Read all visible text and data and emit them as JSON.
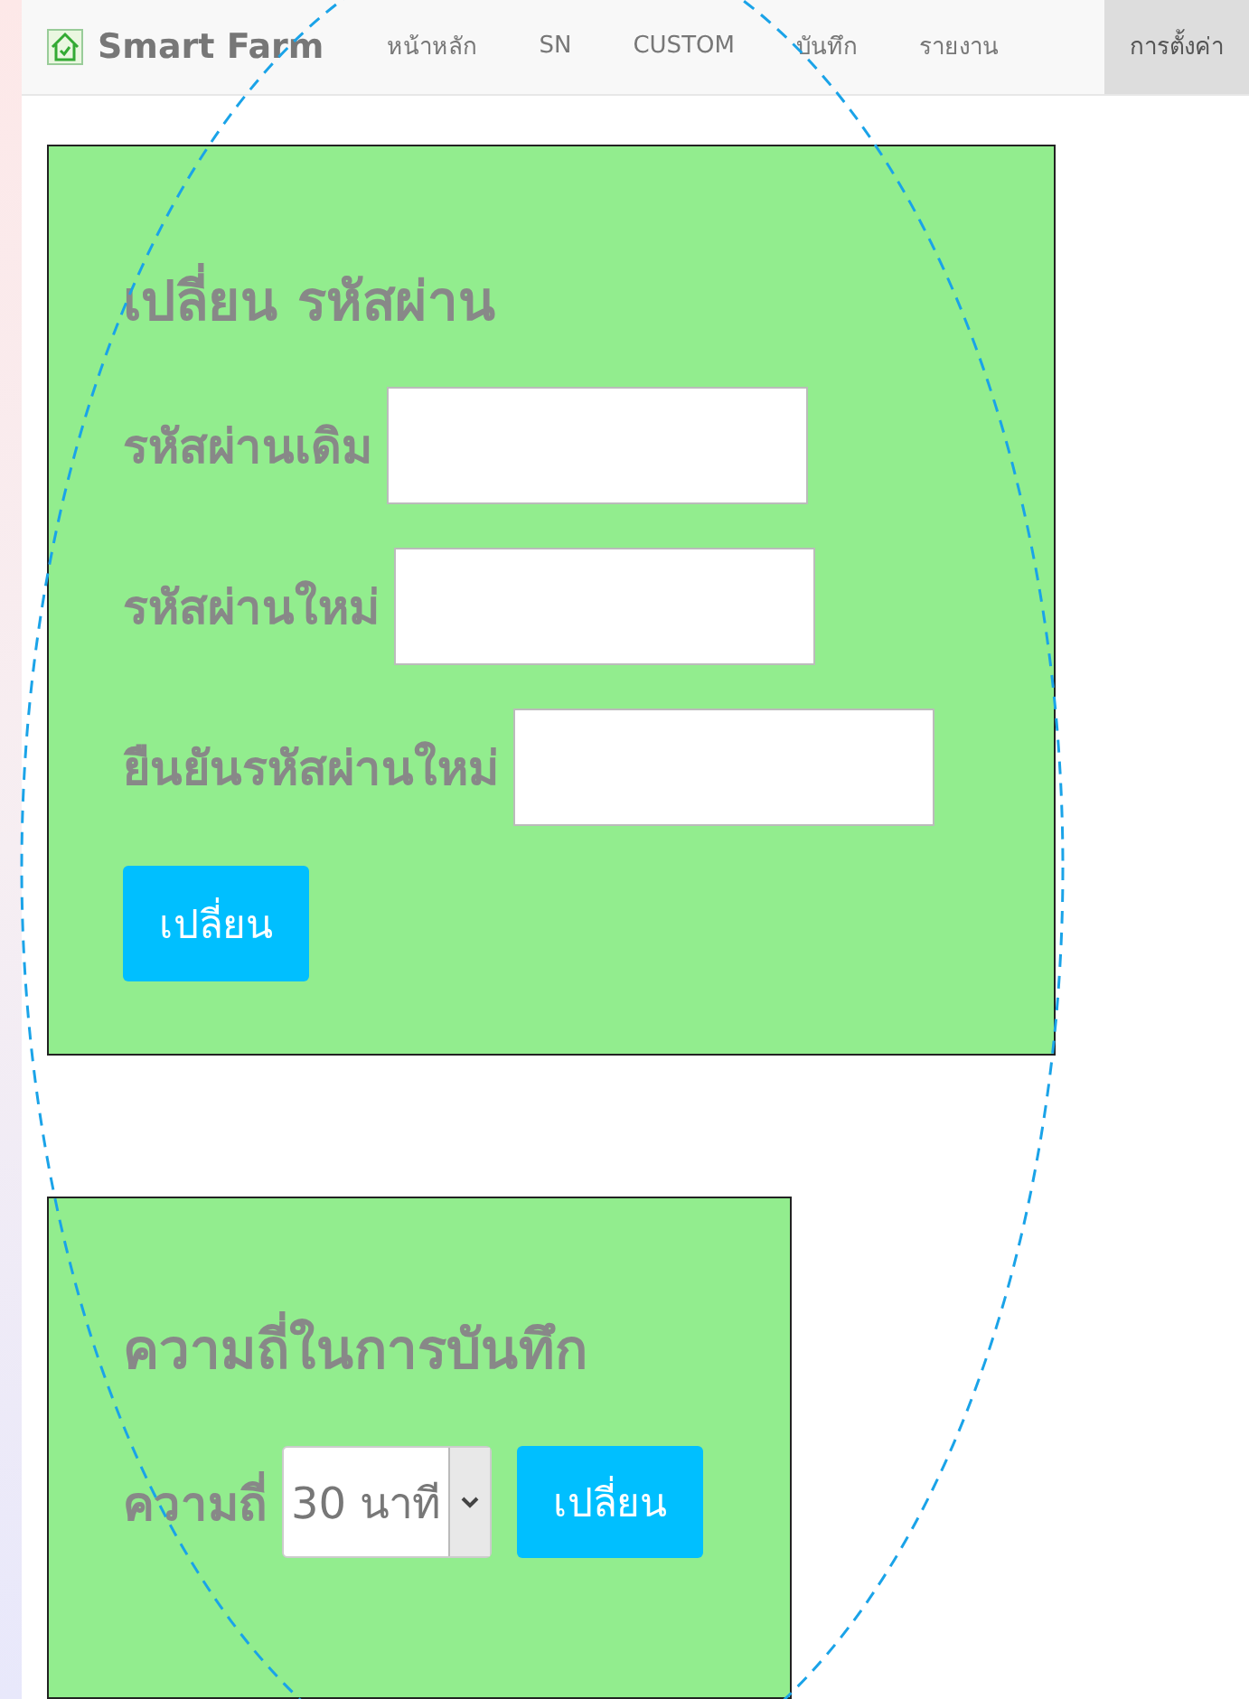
{
  "navbar": {
    "brand": "Smart Farm",
    "items": [
      {
        "label": "หน้าหลัก",
        "selected": false
      },
      {
        "label": "SN",
        "selected": false
      },
      {
        "label": "CUSTOM",
        "selected": false
      },
      {
        "label": "บันทึก",
        "selected": false
      },
      {
        "label": "รายงาน",
        "selected": false
      },
      {
        "label": "การตั้งค่า",
        "selected": true
      }
    ]
  },
  "password_form": {
    "title": "เปลี่ยน รหัสผ่าน",
    "fields": [
      {
        "label": "รหัสผ่านเดิม"
      },
      {
        "label": "รหัสผ่านใหม่"
      },
      {
        "label": "ยืนยันรหัสผ่านใหม่"
      }
    ],
    "button": "เปลี่ยน"
  },
  "frequency_form": {
    "title": "ความถี่ในการบันทึก",
    "label": "ความถี่",
    "value": "30 นาที",
    "button": "เปลี่ยน"
  }
}
